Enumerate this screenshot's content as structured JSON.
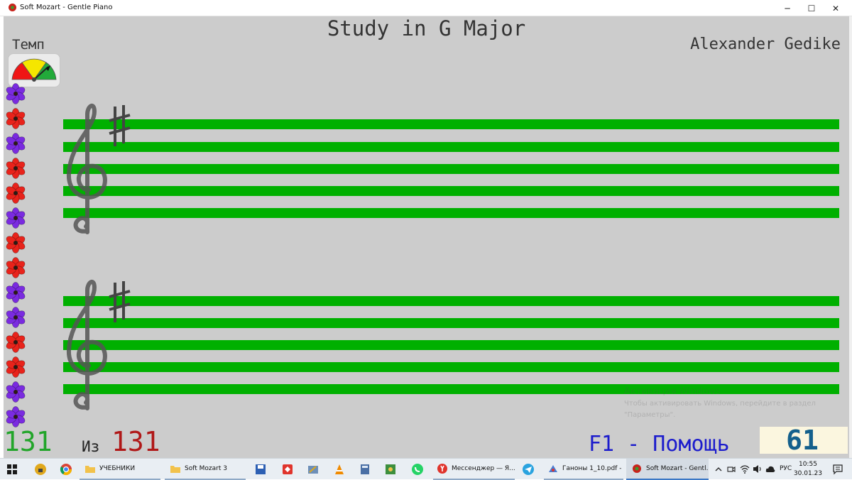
{
  "window": {
    "title": "Soft Mozart - Gentle Piano",
    "minimize_glyph": "─",
    "maximize_glyph": "☐",
    "close_glyph": "✕"
  },
  "score": {
    "title": "Study in G Major",
    "composer": "Alexander Gedike"
  },
  "tempo": {
    "label": "Темп",
    "value": "61",
    "gauge_colors": [
      "#f01515",
      "#f5e600",
      "#22aa3a"
    ]
  },
  "progress": {
    "current": "131",
    "of_label": "Из",
    "total": "131"
  },
  "help_hint": "F1 - Помощь",
  "flowers": [
    "purple",
    "red",
    "purple",
    "red",
    "red",
    "purple",
    "red",
    "red",
    "purple",
    "purple",
    "red",
    "red",
    "purple",
    "purple"
  ],
  "colors": {
    "staff_line": "#00b000",
    "flower_red": "#e8231b",
    "flower_purple": "#7a2be0",
    "background": "#cccccc"
  },
  "watermark": {
    "line1": "Активация Windows",
    "line2": "Чтобы активировать Windows, перейдите в раздел",
    "line3": "\"Параметры\"."
  },
  "taskbar": {
    "items": [
      {
        "label": "УЧЕБНИКИ",
        "icon": "folder-icon"
      },
      {
        "label": "Soft Mozart 3",
        "icon": "folder-icon"
      },
      {
        "label": "Мессенджер — Я...",
        "icon": "yandex-icon"
      },
      {
        "label": "Ганоны 1_10.pdf - ...",
        "icon": "pdf-reader-icon"
      },
      {
        "label": "Soft Mozart - Gentl...",
        "icon": "soft-mozart-icon"
      }
    ],
    "tray": {
      "language": "РУС",
      "time": "10:55",
      "date": "30.01.23"
    }
  }
}
